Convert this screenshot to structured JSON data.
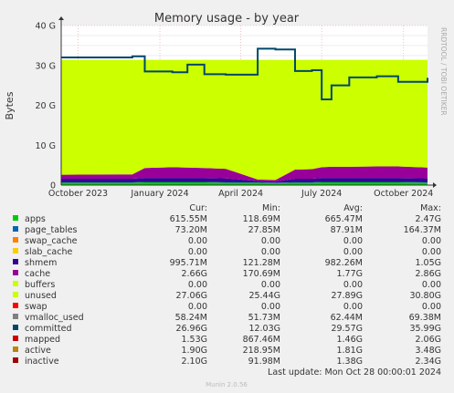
{
  "chart_data": {
    "type": "area",
    "title": "Memory usage - by year",
    "ylabel": "Bytes",
    "side_label": "RRDTOOL / TOBI OETIKER",
    "ylim": [
      0,
      40
    ],
    "y_unit": "G",
    "yticks": [
      {
        "value": 0,
        "label": "0"
      },
      {
        "value": 10,
        "label": "10 G"
      },
      {
        "value": 20,
        "label": "20 G"
      },
      {
        "value": 30,
        "label": "30 G"
      },
      {
        "value": 40,
        "label": "40 G"
      }
    ],
    "x_range": [
      "2023-09-12",
      "2024-10-28"
    ],
    "xticks": [
      {
        "date": "2023-10-01",
        "label": "October 2023"
      },
      {
        "date": "2024-01-01",
        "label": "January 2024"
      },
      {
        "date": "2024-04-01",
        "label": "April 2024"
      },
      {
        "date": "2024-07-01",
        "label": "July 2024"
      },
      {
        "date": "2024-10-01",
        "label": "October 2024"
      }
    ],
    "x": [
      "2023-09-12",
      "2023-12-01",
      "2023-12-15",
      "2024-01-15",
      "2024-02-01",
      "2024-02-20",
      "2024-03-15",
      "2024-04-20",
      "2024-05-10",
      "2024-06-01",
      "2024-06-20",
      "2024-07-01",
      "2024-07-12",
      "2024-08-01",
      "2024-09-01",
      "2024-09-25",
      "2024-10-28"
    ],
    "series": [
      {
        "name": "apps",
        "values": [
          0.6,
          0.6,
          0.7,
          0.7,
          0.7,
          0.7,
          0.6,
          0.6,
          0.5,
          0.6,
          0.6,
          0.7,
          0.7,
          0.7,
          0.7,
          0.7,
          0.6
        ]
      },
      {
        "name": "page_tables",
        "values": [
          0.1,
          0.1,
          0.1,
          0.1,
          0.1,
          0.1,
          0.1,
          0.1,
          0.1,
          0.1,
          0.1,
          0.1,
          0.1,
          0.1,
          0.1,
          0.1,
          0.1
        ]
      },
      {
        "name": "shmem",
        "values": [
          0.9,
          0.9,
          1.0,
          1.0,
          1.0,
          1.0,
          1.0,
          0.3,
          0.3,
          0.9,
          0.9,
          1.0,
          1.0,
          1.0,
          1.0,
          1.0,
          1.0
        ]
      },
      {
        "name": "cache",
        "values": [
          1.0,
          1.1,
          2.5,
          2.7,
          2.6,
          2.5,
          2.4,
          0.4,
          0.4,
          2.3,
          2.4,
          2.7,
          2.8,
          2.8,
          2.9,
          2.9,
          2.7
        ]
      },
      {
        "name": "unused",
        "values": [
          28.8,
          28.7,
          27.1,
          26.9,
          27.0,
          27.1,
          27.3,
          30.0,
          30.1,
          27.5,
          27.4,
          26.9,
          26.8,
          26.8,
          26.7,
          26.7,
          27.0
        ]
      },
      {
        "name": "committed",
        "values": [
          32.0,
          32.3,
          28.5,
          28.3,
          30.2,
          27.8,
          27.7,
          34.2,
          34.0,
          28.6,
          28.8,
          21.5,
          25.0,
          27.0,
          27.3,
          25.9,
          26.9
        ]
      }
    ]
  },
  "legend_header": {
    "cur": "Cur:",
    "min": "Min:",
    "avg": "Avg:",
    "max": "Max:"
  },
  "legend": [
    {
      "name": "apps",
      "color": "#00cc00",
      "cur": "615.55M",
      "min": "118.69M",
      "avg": "665.47M",
      "max": "2.47G"
    },
    {
      "name": "page_tables",
      "color": "#0066b3",
      "cur": "73.20M",
      "min": "27.85M",
      "avg": "87.91M",
      "max": "164.37M"
    },
    {
      "name": "swap_cache",
      "color": "#ff8000",
      "cur": "0.00",
      "min": "0.00",
      "avg": "0.00",
      "max": "0.00"
    },
    {
      "name": "slab_cache",
      "color": "#ffcc00",
      "cur": "0.00",
      "min": "0.00",
      "avg": "0.00",
      "max": "0.00"
    },
    {
      "name": "shmem",
      "color": "#330099",
      "cur": "995.71M",
      "min": "121.28M",
      "avg": "982.26M",
      "max": "1.05G"
    },
    {
      "name": "cache",
      "color": "#990099",
      "cur": "2.66G",
      "min": "170.69M",
      "avg": "1.77G",
      "max": "2.86G"
    },
    {
      "name": "buffers",
      "color": "#ccff00",
      "cur": "0.00",
      "min": "0.00",
      "avg": "0.00",
      "max": "0.00"
    },
    {
      "name": "unused",
      "color": "#ccff00",
      "cur": "27.06G",
      "min": "25.44G",
      "avg": "27.89G",
      "max": "30.80G"
    },
    {
      "name": "swap",
      "color": "#ff0000",
      "cur": "0.00",
      "min": "0.00",
      "avg": "0.00",
      "max": "0.00"
    },
    {
      "name": "vmalloc_used",
      "color": "#808080",
      "cur": "58.24M",
      "min": "51.73M",
      "avg": "62.44M",
      "max": "69.38M"
    },
    {
      "name": "committed",
      "color": "#00476b",
      "cur": "26.96G",
      "min": "12.03G",
      "avg": "29.57G",
      "max": "35.99G"
    },
    {
      "name": "mapped",
      "color": "#cc0000",
      "cur": "1.53G",
      "min": "867.46M",
      "avg": "1.46G",
      "max": "2.06G"
    },
    {
      "name": "active",
      "color": "#b8860b",
      "cur": "1.90G",
      "min": "218.95M",
      "avg": "1.81G",
      "max": "3.48G"
    },
    {
      "name": "inactive",
      "color": "#a00000",
      "cur": "2.10G",
      "min": "91.98M",
      "avg": "1.38G",
      "max": "2.34G"
    }
  ],
  "last_update": "Last update: Mon Oct 28 00:00:01 2024",
  "footer": "Munin 2.0.56",
  "colors": {
    "background": "#f0f0f0",
    "plot_bg": "#ffffff",
    "grid": "#e4b4b4",
    "axis": "#333333"
  }
}
